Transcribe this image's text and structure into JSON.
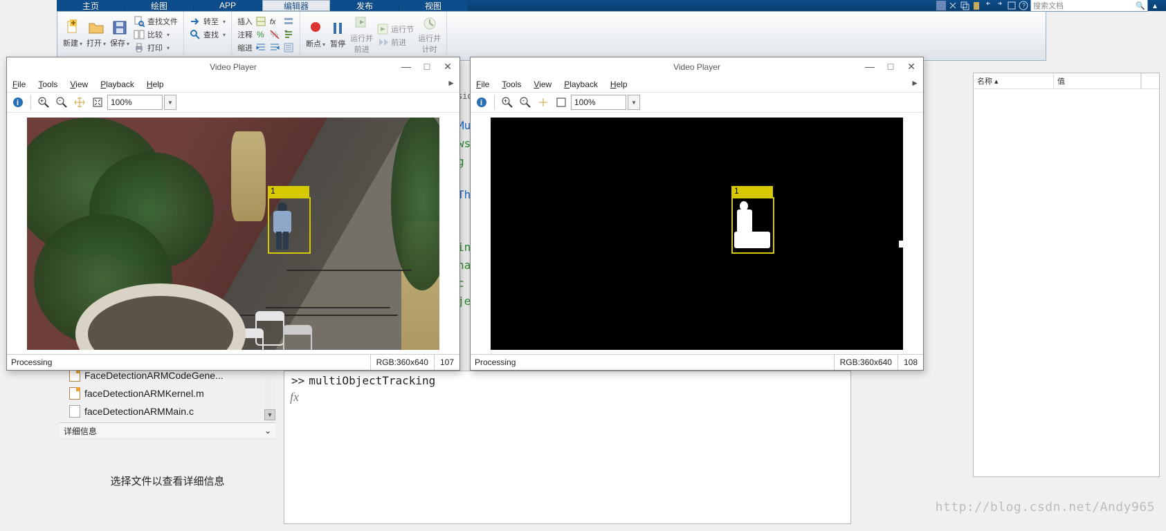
{
  "ribbon": {
    "tabs": [
      "主页",
      "绘图",
      "APP",
      "编辑器",
      "发布",
      "视图"
    ],
    "selected_tab": "编辑器",
    "groups": {
      "file": {
        "new": "新建",
        "open": "打开",
        "save": "保存",
        "findfiles": "查找文件",
        "compare": "比较",
        "print": "打印"
      },
      "nav": {
        "goto": "转至",
        "find": "查找"
      },
      "edit": {
        "insert": "插入",
        "comment": "注释",
        "indent": "缩进",
        "fx": "fx"
      },
      "run": {
        "breakpoint": "断点",
        "pause": "暂停",
        "run_advance": "运行并\n前进",
        "run_section": "运行节",
        "advance": "前进",
        "run_time": "运行并\n计时"
      }
    },
    "search_placeholder": "搜索文档"
  },
  "workspace": {
    "toolbar_title": "",
    "cols": [
      "名称 ▴",
      "值"
    ]
  },
  "filebrowser": {
    "rows": [
      {
        "name": "FaceDetectionARMCodeGene...",
        "type": "m"
      },
      {
        "name": "faceDetectionARMKernel.m",
        "type": "m"
      },
      {
        "name": "faceDetectionARMMain.c",
        "type": "c"
      }
    ],
    "details_title": "详细信息",
    "details_body": "选择文件以查看详细信息"
  },
  "command": {
    "prompt": ">> ",
    "line": "multiObjectTracking"
  },
  "peek": {
    "l1": "Mu",
    "l2": "ws",
    "l3": "g",
    "l4": "Th",
    "l5": "ing",
    "l6": "nar",
    "l7": "c r",
    "l8": "jec",
    "l9": "sio..."
  },
  "vp": {
    "title": "Video Player",
    "menus": [
      "File",
      "Tools",
      "View",
      "Playback",
      "Help"
    ],
    "tools": {
      "zoom": "100%"
    },
    "status_left": "Processing",
    "status_rgb": "RGB:360x640",
    "left": {
      "frame": "107",
      "track_label": "1"
    },
    "right": {
      "frame": "108",
      "track_label": "1"
    }
  },
  "watermark": "http://blog.csdn.net/Andy965"
}
